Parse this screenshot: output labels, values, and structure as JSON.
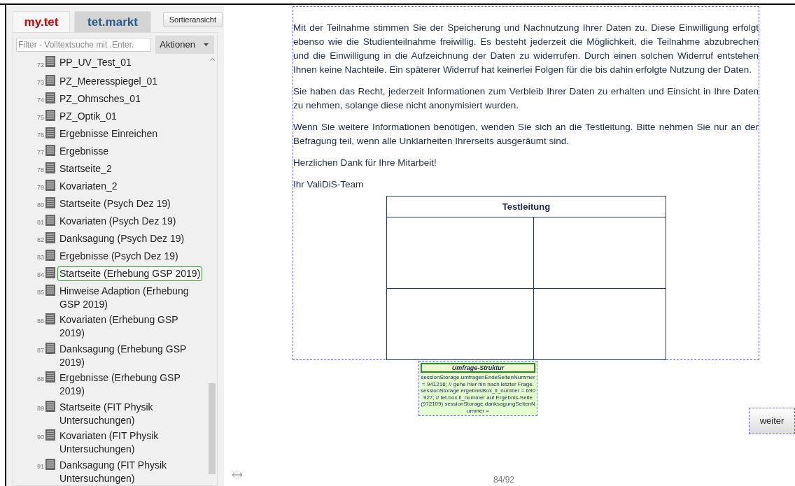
{
  "sidebar": {
    "tabs": [
      {
        "label": "my.tet",
        "selected": true
      },
      {
        "label": "tet.markt",
        "selected": false
      }
    ],
    "sort_button": "Sortieransicht",
    "filter": {
      "placeholder": "Filter - Volltextsuche mit .Enter."
    },
    "actions_dropdown": "Aktionen",
    "items": [
      {
        "number": "72",
        "label": "PP_UV_Test_01",
        "selected": false
      },
      {
        "number": "73",
        "label": "PZ_Meeresspiegel_01",
        "selected": false
      },
      {
        "number": "74",
        "label": "PZ_Ohmsches_01",
        "selected": false
      },
      {
        "number": "75",
        "label": "PZ_Optik_01",
        "selected": false
      },
      {
        "number": "76",
        "label": "Ergebnisse Einreichen",
        "selected": false
      },
      {
        "number": "77",
        "label": "Ergebnisse",
        "selected": false
      },
      {
        "number": "78",
        "label": "Startseite_2",
        "selected": false
      },
      {
        "number": "79",
        "label": "Kovariaten_2",
        "selected": false
      },
      {
        "number": "80",
        "label": "Startseite (Psych Dez 19)",
        "selected": false
      },
      {
        "number": "81",
        "label": "Kovariaten (Psych Dez 19)",
        "selected": false
      },
      {
        "number": "82",
        "label": "Danksagung (Psych Dez 19)",
        "selected": false
      },
      {
        "number": "83",
        "label": "Ergebnisse (Psych Dez 19)",
        "selected": false
      },
      {
        "number": "84",
        "label": "Startseite (Erhebung GSP 2019)",
        "selected": true
      },
      {
        "number": "85",
        "label": "Hinweise Adaption (Erhebung GSP 2019)",
        "selected": false
      },
      {
        "number": "86",
        "label": "Kovariaten (Erhebung GSP 2019)",
        "selected": false
      },
      {
        "number": "87",
        "label": "Danksagung (Erhebung GSP 2019)",
        "selected": false
      },
      {
        "number": "88",
        "label": "Ergebnisse (Erhebung GSP 2019)",
        "selected": false
      },
      {
        "number": "89",
        "label": "Startseite (FIT Physik Untersuchungen)",
        "selected": false
      },
      {
        "number": "90",
        "label": "Kovariaten (FIT Physik Untersuchungen)",
        "selected": false
      },
      {
        "number": "91",
        "label": "Danksagung (FIT Physik Untersuchungen)",
        "selected": false
      }
    ]
  },
  "page": {
    "paragraphs": [
      "Mit der Teilnahme stimmen Sie der Speicherung und Nachnutzung Ihrer Daten zu. Diese Einwilligung erfolgt ebenso wie die Studienteilnahme freiwillig. Es besteht jederzeit die Möglichkeit, die Teilnahme abzubrechen und die Einwilligung in die Aufzeichnung der Daten zu widerrufen. Durch einen solchen Widerruf entstehen Ihnen keine Nachteile. Ein späterer Widerruf hat keinerlei Folgen für die bis dahin erfolgte Nutzung der Daten.",
      "Sie haben das Recht, jederzeit Informationen zum Verbleib Ihrer Daten zu erhalten und Einsicht in Ihre Daten zu nehmen, solange diese nicht anonymisiert wurden.",
      "Wenn Sie weitere Informationen benötigen, wenden Sie sich an die Testleitung. Bitte nehmen Sie nur an der Befragung teil, wenn alle Unklarheiten Ihrerseits ausgeräumt sind.",
      "Herzlichen Dank für Ihre Mitarbeit!",
      "Ihr ValiDiS-Team"
    ],
    "table": {
      "header": "Testleitung"
    },
    "code_box": {
      "title": "Umfrage-Struktur",
      "text": "sessionStorage.umfragenEndeSeitenNummer = 941216; // gehe hier hin nach letzter Frage. sessionStorage.ergebnisBox_ll_number = 690927; // tet.box.ll_nummer auf Ergebnis-Seite (972109) sessionStorage.danksagungSeitenNummer ="
    },
    "next_button": "weiter",
    "page_number": "84/92"
  }
}
